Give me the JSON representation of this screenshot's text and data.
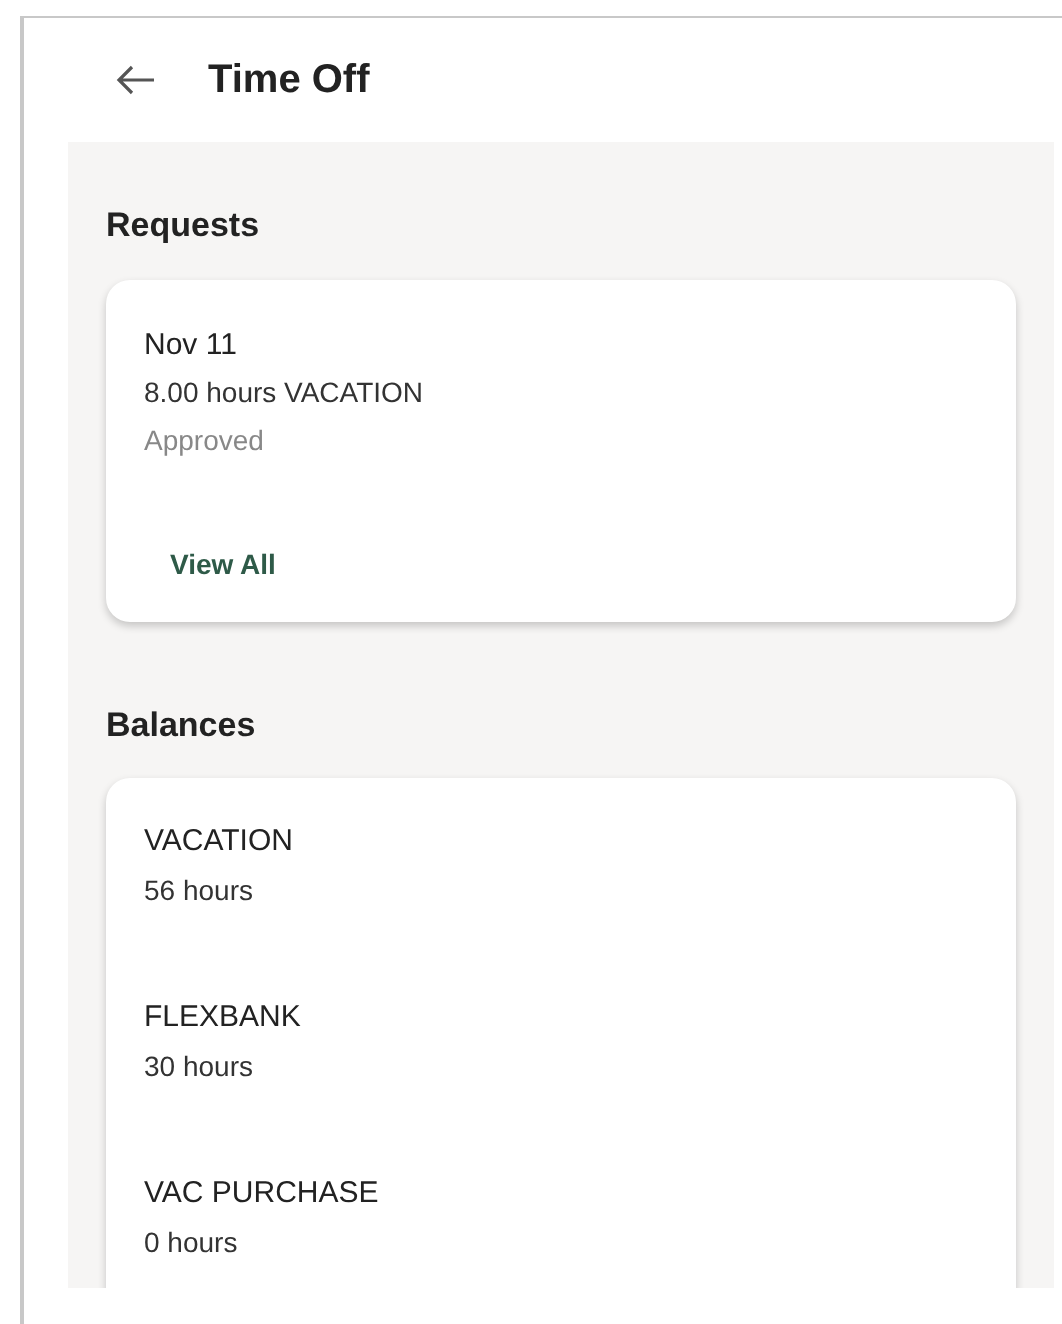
{
  "header": {
    "title": "Time Off"
  },
  "requests": {
    "heading": "Requests",
    "items": [
      {
        "date": "Nov 11",
        "detail": "8.00 hours VACATION",
        "status": "Approved"
      }
    ],
    "link": "View All"
  },
  "balances": {
    "heading": "Balances",
    "items": [
      {
        "name": "VACATION",
        "amount": "56 hours"
      },
      {
        "name": "FLEXBANK",
        "amount": "30 hours"
      },
      {
        "name": "VAC PURCHASE",
        "amount": "0 hours"
      }
    ]
  }
}
